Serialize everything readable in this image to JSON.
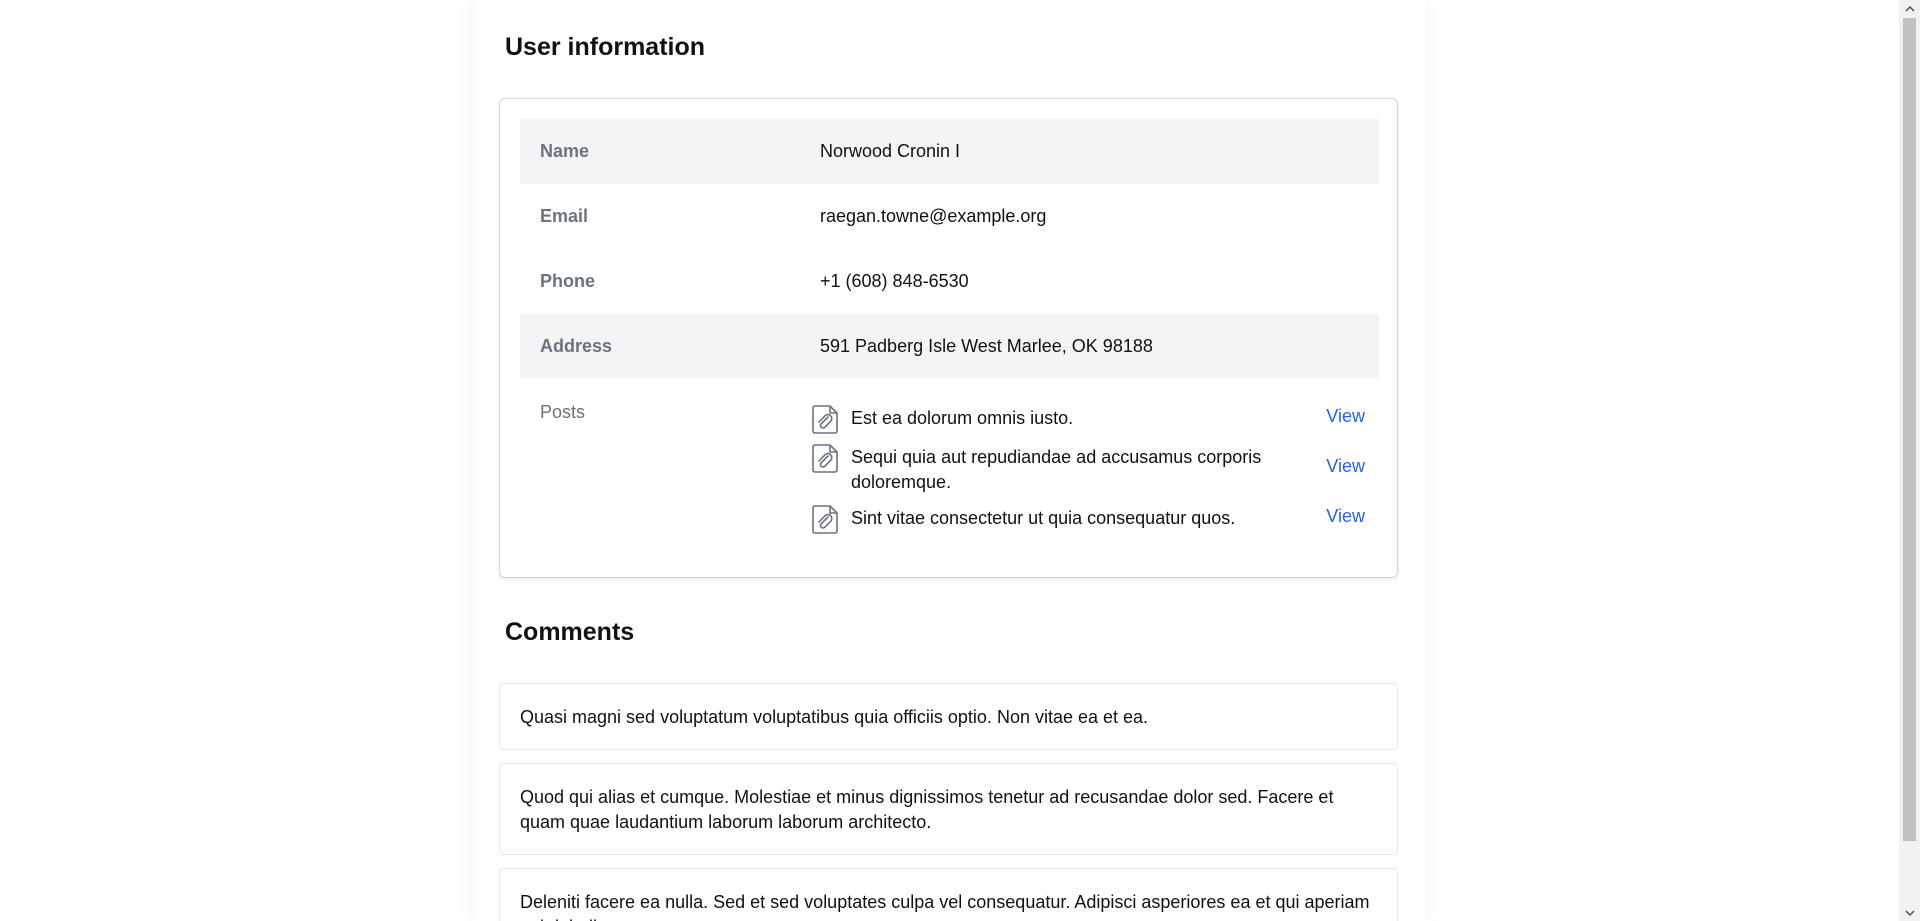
{
  "user_info": {
    "title": "User information",
    "fields": [
      {
        "label": "Name",
        "value": "Norwood Cronin I"
      },
      {
        "label": "Email",
        "value": "raegan.towne@example.org"
      },
      {
        "label": "Phone",
        "value": "+1 (608) 848-6530"
      },
      {
        "label": "Address",
        "value": "591 Padberg Isle West Marlee, OK 98188"
      }
    ],
    "posts_label": "Posts",
    "posts": [
      {
        "title": "Est ea dolorum omnis iusto.",
        "action": "View",
        "icon": "paperclip-document-icon"
      },
      {
        "title": "Sequi quia aut repudiandae ad accusamus corporis doloremque.",
        "action": "View",
        "icon": "paperclip-document-icon"
      },
      {
        "title": "Sint vitae consectetur ut quia consequatur quos.",
        "action": "View",
        "icon": "paperclip-document-icon"
      }
    ]
  },
  "comments": {
    "title": "Comments",
    "items": [
      "Quasi magni sed voluptatum voluptatibus quia officiis optio. Non vitae ea et ea.",
      "Quod qui alias et cumque. Molestiae et minus dignissimos tenetur ad recusandae dolor sed. Facere et quam quae laudantium laborum laborum architecto.",
      "Deleniti facere ea nulla. Sed et sed voluptates culpa vel consequatur. Adipisci asperiores ea et qui aperiam qui dolorib"
    ]
  },
  "colors": {
    "link": "#2563eb",
    "label": "#6b7280",
    "row_shade": "#f3f4f6",
    "border": "#d1d5db"
  }
}
